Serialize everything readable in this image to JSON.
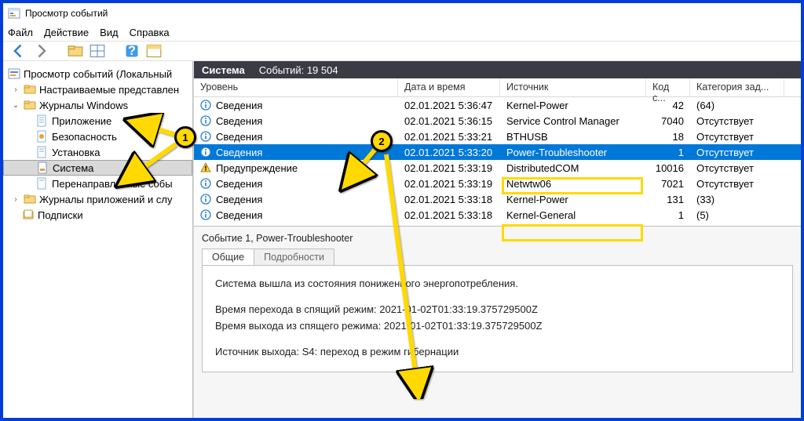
{
  "window": {
    "title": "Просмотр событий"
  },
  "menu": {
    "file": "Файл",
    "action": "Действие",
    "view": "Вид",
    "help": "Справка"
  },
  "tree": {
    "root": "Просмотр событий (Локальный",
    "custom": "Настраиваемые представлен",
    "winlogs": "Журналы Windows",
    "app": "Приложение",
    "sec": "Безопасность",
    "setup": "Установка",
    "system": "Система",
    "forwarded": "Перенаправленные собы",
    "appsvc": "Журналы приложений и слу",
    "subs": "Подписки"
  },
  "paneheader": {
    "title": "Система",
    "count_label": "Событий: 19 504"
  },
  "columns": {
    "level": "Уровень",
    "date": "Дата и время",
    "source": "Источник",
    "id": "Код с...",
    "task": "Категория зад..."
  },
  "rows": [
    {
      "level": "Сведения",
      "icon": "info",
      "date": "02.01.2021 5:36:47",
      "src": "Kernel-Power",
      "id": "42",
      "task": "(64)"
    },
    {
      "level": "Сведения",
      "icon": "info",
      "date": "02.01.2021 5:36:15",
      "src": "Service Control Manager",
      "id": "7040",
      "task": "Отсутствует"
    },
    {
      "level": "Сведения",
      "icon": "info",
      "date": "02.01.2021 5:33:21",
      "src": "BTHUSB",
      "id": "18",
      "task": "Отсутствует"
    },
    {
      "level": "Сведения",
      "icon": "info",
      "date": "02.01.2021 5:33:20",
      "src": "Power-Troubleshooter",
      "id": "1",
      "task": "Отсутствует",
      "sel": true
    },
    {
      "level": "Предупреждение",
      "icon": "warn",
      "date": "02.01.2021 5:33:19",
      "src": "DistributedCOM",
      "id": "10016",
      "task": "Отсутствует"
    },
    {
      "level": "Сведения",
      "icon": "info",
      "date": "02.01.2021 5:33:19",
      "src": "Netwtw06",
      "id": "7021",
      "task": "Отсутствует"
    },
    {
      "level": "Сведения",
      "icon": "info",
      "date": "02.01.2021 5:33:18",
      "src": "Kernel-Power",
      "id": "131",
      "task": "(33)"
    },
    {
      "level": "Сведения",
      "icon": "info",
      "date": "02.01.2021 5:33:18",
      "src": "Kernel-General",
      "id": "1",
      "task": "(5)"
    }
  ],
  "details": {
    "title": "Событие 1, Power-Troubleshooter",
    "tabs": {
      "general": "Общие",
      "details": "Подробности"
    },
    "body": {
      "l1": "Система вышла из состояния пониженного энергопотребления.",
      "l2": "Время перехода в спящий режим: 2021-01-02T01:33:19.375729500Z",
      "l3": "Время выхода из спящего режима: 2021-01-02T01:33:19.375729500Z",
      "l4": "Источник выхода: S4: переход в режим гибернации"
    }
  },
  "annotations": {
    "badge1": "1",
    "badge2": "2"
  }
}
